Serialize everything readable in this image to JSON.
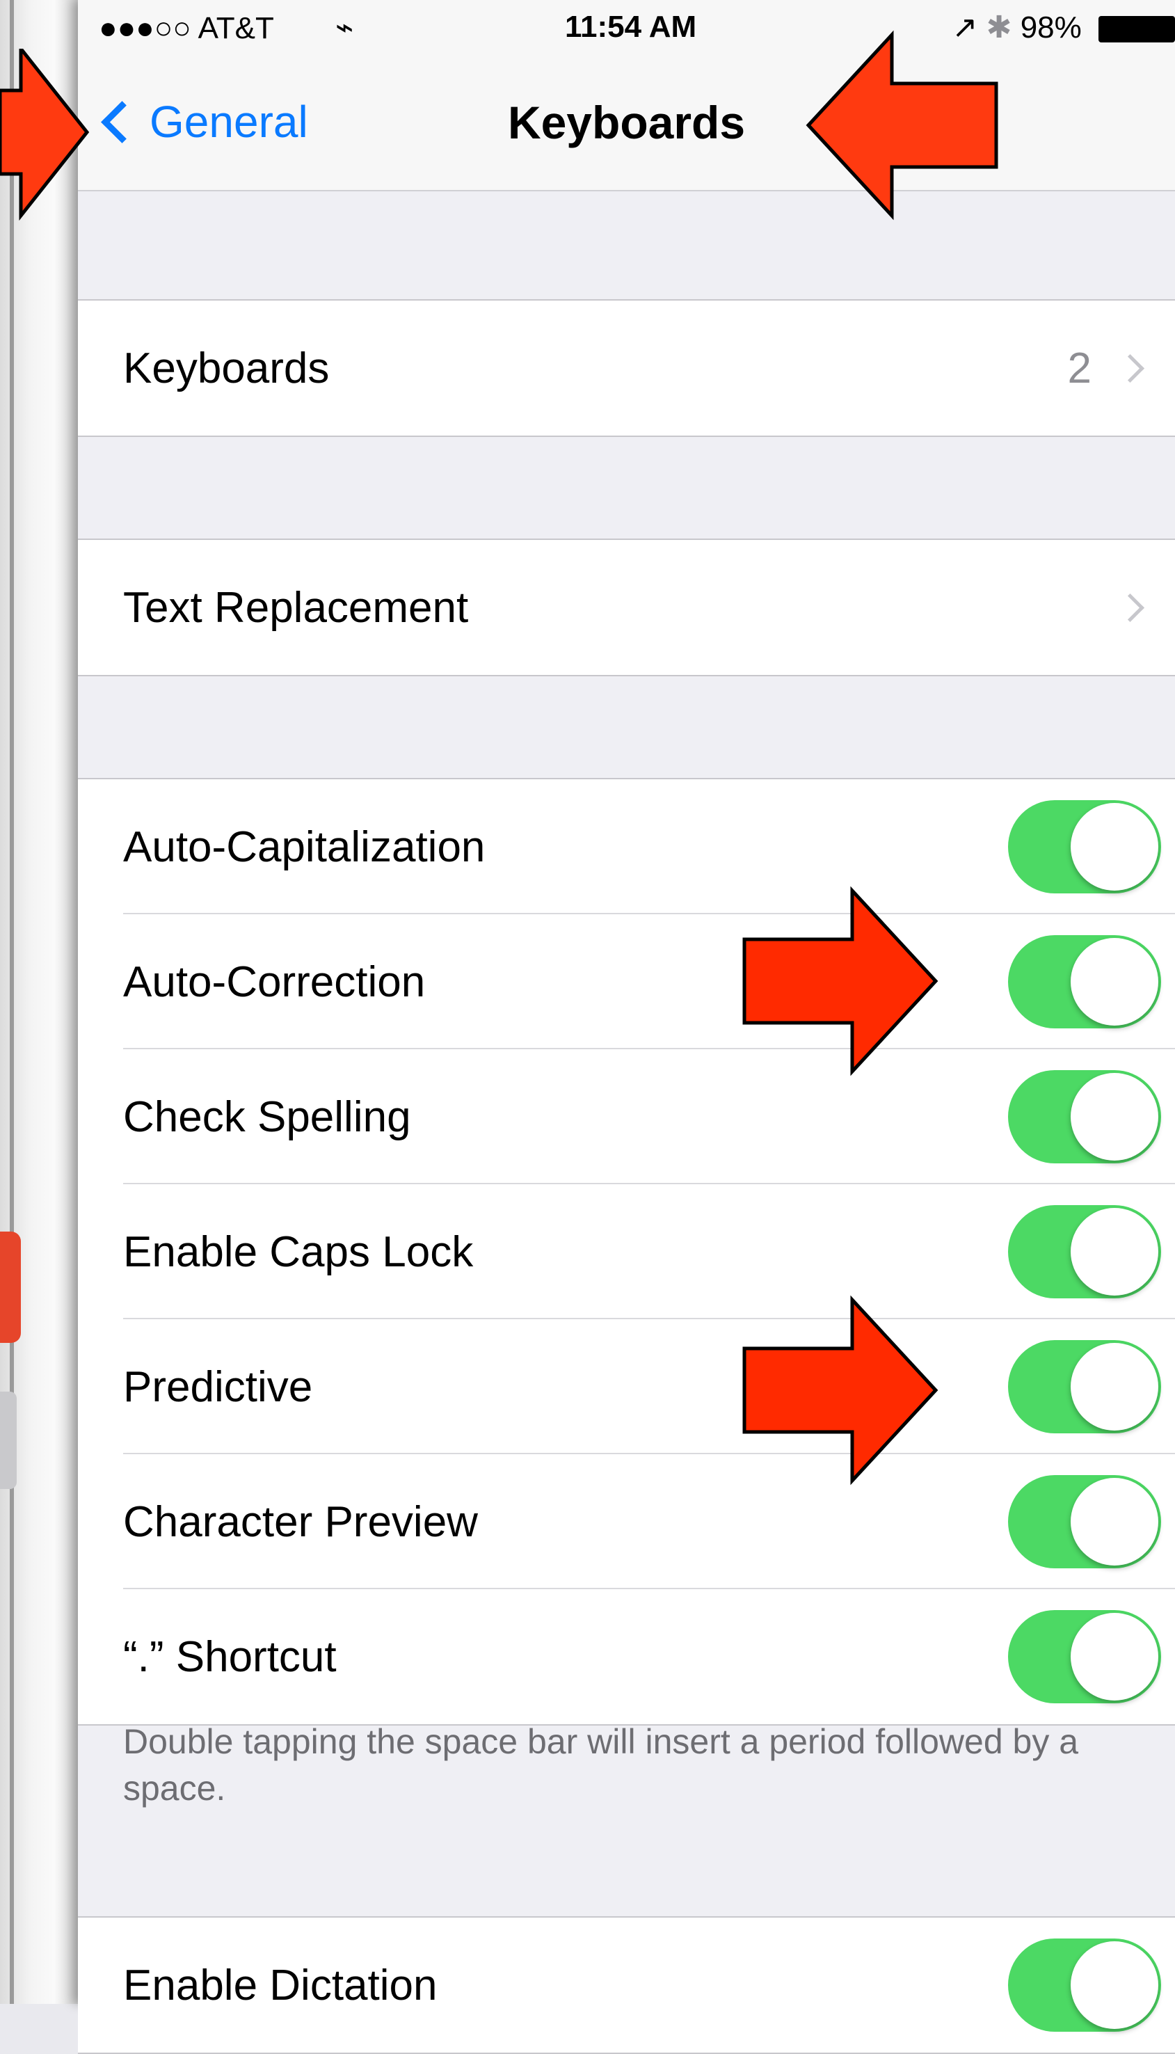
{
  "status_bar": {
    "carrier": "●●●○○ AT&T",
    "time": "11:54 AM",
    "battery": "98%"
  },
  "nav": {
    "back_label": "General",
    "title": "Keyboards"
  },
  "keyboards_row": {
    "label": "Keyboards",
    "count": "2"
  },
  "text_replacement": {
    "label": "Text Replacement"
  },
  "toggles": [
    {
      "label": "Auto-Capitalization",
      "on": true
    },
    {
      "label": "Auto-Correction",
      "on": true
    },
    {
      "label": "Check Spelling",
      "on": true
    },
    {
      "label": "Enable Caps Lock",
      "on": true
    },
    {
      "label": "Predictive",
      "on": true
    },
    {
      "label": "Character Preview",
      "on": true
    },
    {
      "label": "“.” Shortcut",
      "on": true
    }
  ],
  "footnote": "Double tapping the space bar will insert a period followed by a space.",
  "dictation": {
    "label": "Enable Dictation",
    "on": true
  },
  "colors": {
    "toggle_on": "#4cd964",
    "link_blue": "#0a7aff",
    "arrow_red": "#ff2a00"
  }
}
